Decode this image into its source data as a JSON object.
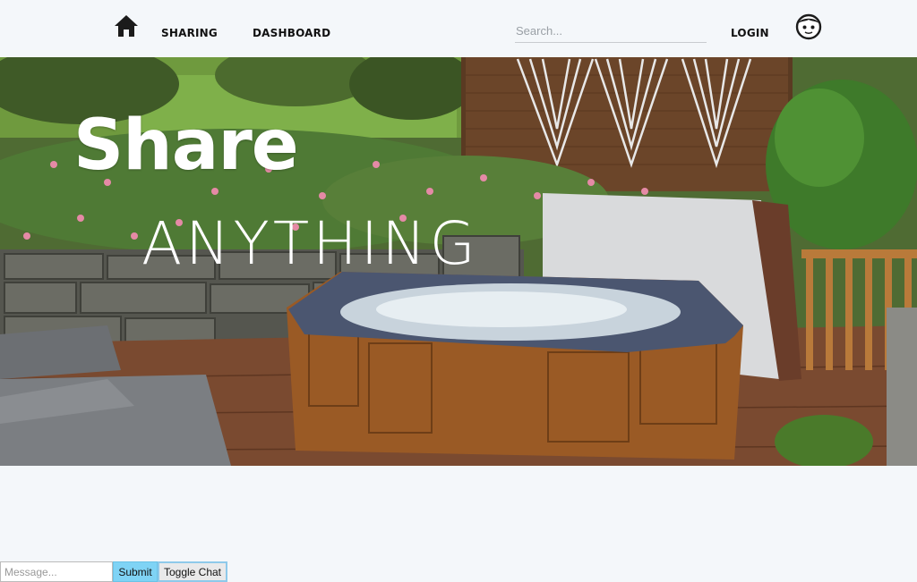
{
  "nav": {
    "home_icon": "home-icon",
    "links": {
      "sharing": "SHARING",
      "dashboard": "DASHBOARD",
      "login": "LOGIN"
    },
    "search_placeholder": "Search...",
    "avatar_icon": "avatar-icon"
  },
  "hero": {
    "title": "Share",
    "subtitle": "ANYTHING"
  },
  "chat": {
    "message_placeholder": "Message...",
    "submit_label": "Submit",
    "toggle_label": "Toggle Chat"
  },
  "colors": {
    "page_bg": "#f4f7fa",
    "submit_bg": "#7fd3f5",
    "toggle_border": "#8ec9ea"
  }
}
